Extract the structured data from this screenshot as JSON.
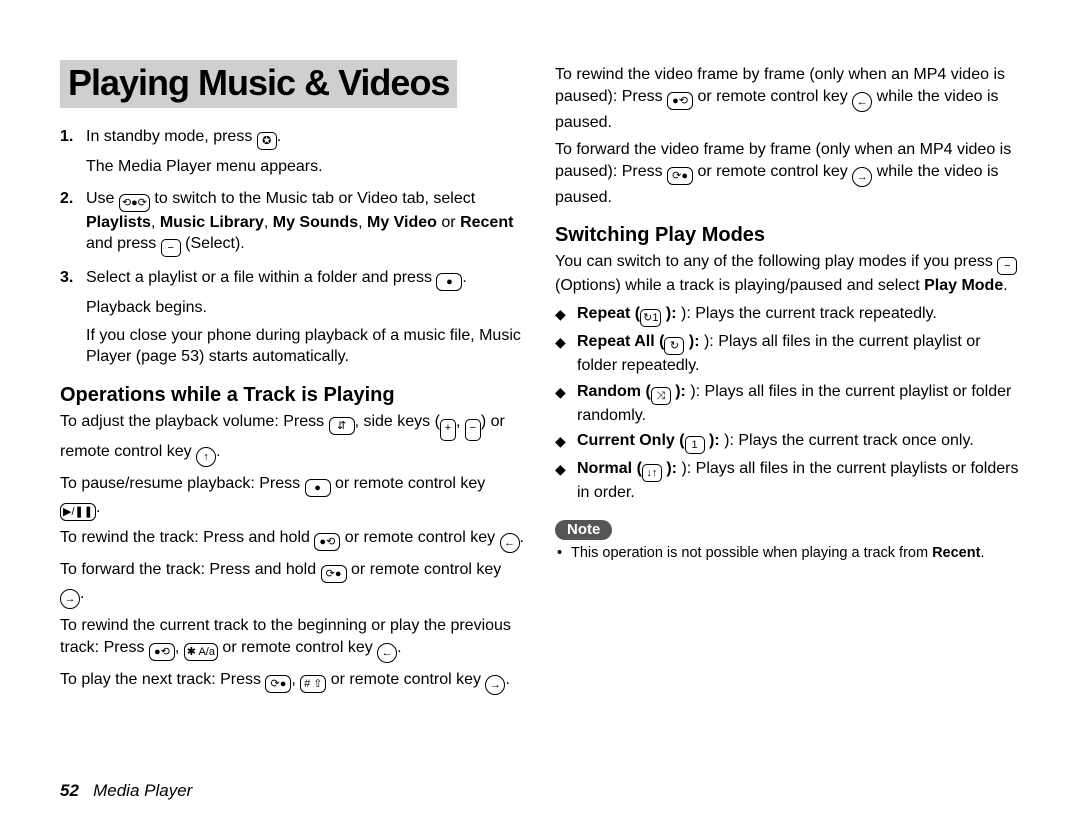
{
  "title": "Playing Music & Videos",
  "steps": {
    "s1a": "In standby mode, press ",
    "s1b": ".",
    "s1c": "The Media Player menu appears.",
    "s2a": "Use ",
    "s2b": " to switch to the Music tab or Video tab, select ",
    "s2c": "Playlists",
    "s2d": ", ",
    "s2e": "Music Library",
    "s2f": ", ",
    "s2g": "My Sounds",
    "s2h": ", ",
    "s2i": "My Video",
    "s2j": " or ",
    "s2k": "Recent",
    "s2l": " and press ",
    "s2m": " (Select).",
    "s3a": "Select a playlist or a file within a folder and press ",
    "s3b": ".",
    "s3c": "Playback begins.",
    "s3d": "If you close your phone during playback of a music file, Music Player (page 53) starts automatically."
  },
  "icon": {
    "media": "✪",
    "leftright": "⟲●⟳",
    "softkey": "−",
    "center": "●",
    "updown": "⇵",
    "sideplus": "+",
    "sideminus": "−",
    "remote_up": "↑",
    "playpause": "▶/❚❚",
    "left": "●⟲",
    "right": "⟳●",
    "r_prev": "←",
    "r_next": "→",
    "star": "✱ A/a",
    "hash": "# ⇧",
    "repeat1": "↻1",
    "repeatall": "↻",
    "random": "⤨",
    "one": "1",
    "normal": "↓↑"
  },
  "ops_head": "Operations while a Track is Playing",
  "ops": {
    "vol_a": "To adjust the playback volume: Press ",
    "vol_comma": ", side keys (",
    "vol_mid": ", ",
    "vol_b": ") or remote control key ",
    "vol_end": ".",
    "pause_a": "To pause/resume playback: Press ",
    "pause_mid": " or remote control key ",
    "pause_end": ".",
    "rew_a": "To rewind the track: Press and hold ",
    "rew_mid": " or remote control key ",
    "rew_end": ".",
    "fwd_a": "To forward the track: Press and hold ",
    "fwd_mid": " or remote control key ",
    "fwd_end": ".",
    "prev_a": "To rewind the current track to the beginning or play the previous track: Press ",
    "prev_sep": ", ",
    "prev_mid": " or remote control key ",
    "prev_end": ".",
    "next_a": "To play the next track: Press ",
    "next_sep": ", ",
    "next_mid": " or remote control key ",
    "next_end": "."
  },
  "col2": {
    "frame_rew_a": "To rewind the video frame by frame (only when an MP4 video is paused): Press ",
    "frame_rew_mid": " or remote control key ",
    "frame_rew_end": " while the video is paused.",
    "frame_fwd_a": "To forward the video frame by frame (only when an MP4 video is paused): Press ",
    "frame_fwd_mid": " or remote control key ",
    "frame_fwd_end": " while the video is paused."
  },
  "switch_head": "Switching Play Modes",
  "switch_intro_a": "You can switch to any of the following play modes if you press ",
  "switch_intro_b": " (Options) while a track is playing/paused and select ",
  "switch_intro_c": "Play Mode",
  "switch_intro_d": ".",
  "modes": {
    "repeat_t": "Repeat (",
    "repeat_d": " ): Plays the current track repeatedly.",
    "repeat_all_t": "Repeat All (",
    "repeat_all_d": " ): Plays all files in the current playlist or folder repeatedly.",
    "random_t": "Random (",
    "random_d": " ): Plays all files in the current playlist or folder randomly.",
    "current_t": "Current Only (",
    "current_d": " ): Plays the current track once only.",
    "normal_t": "Normal (",
    "normal_d": " ): Plays all files in the current playlists or folders in order."
  },
  "note_label": "Note",
  "note_a": "This operation is not possible when playing a track from ",
  "note_b": "Recent",
  "note_c": ".",
  "footer": {
    "page": "52",
    "section": "Media Player"
  }
}
